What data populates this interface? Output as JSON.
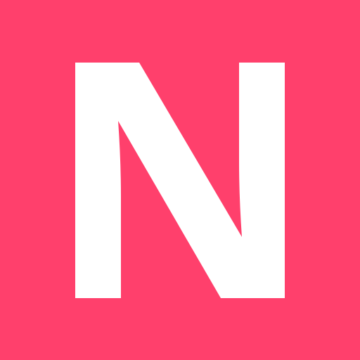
{
  "icon": {
    "name": "n-logo-icon",
    "letter": "N",
    "background_color": "#ff406c",
    "glyph_color": "#ffffff"
  }
}
